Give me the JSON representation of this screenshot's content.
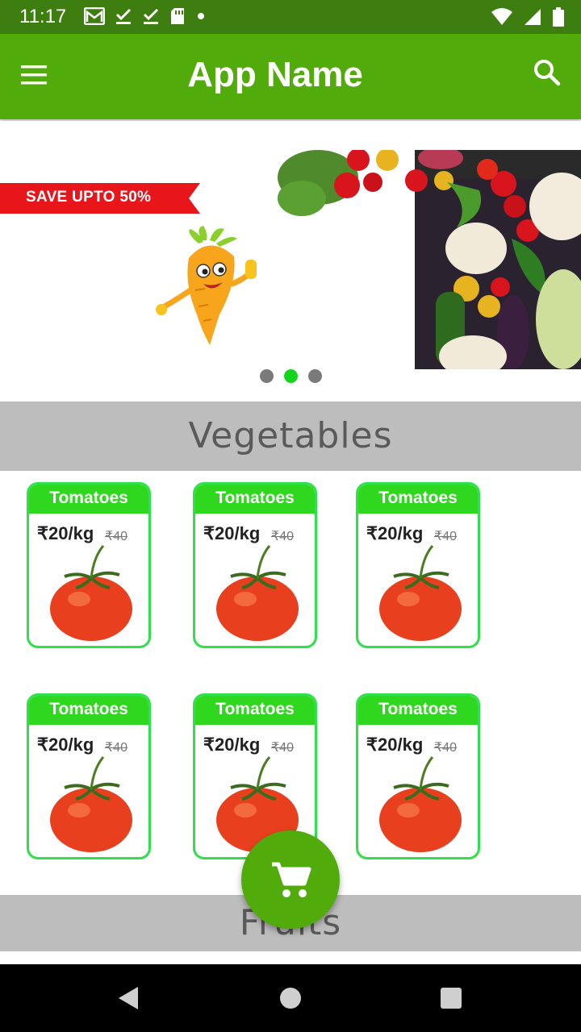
{
  "status_bar": {
    "time": "11:17",
    "left_icons": [
      "gmail-icon",
      "check-icon",
      "check-icon",
      "sd-card-icon",
      "dot-icon"
    ],
    "right_icons": [
      "wifi-icon",
      "signal-icon",
      "battery-icon"
    ]
  },
  "app_bar": {
    "title": "App Name",
    "menu_icon": "menu-icon",
    "search_icon": "search-icon",
    "color": "#51ac0b"
  },
  "banner": {
    "save_label": "SAVE UPTO 50%",
    "ribbon_color": "#e8151b",
    "dots_count": 3,
    "active_dot": 1,
    "active_dot_color": "#14d31c"
  },
  "sections": {
    "vegetables": "Vegetables",
    "fruits": "Fruits"
  },
  "products": [
    {
      "name": "Tomatoes",
      "price": "₹20/kg",
      "old_price": "₹40"
    },
    {
      "name": "Tomatoes",
      "price": "₹20/kg",
      "old_price": "₹40"
    },
    {
      "name": "Tomatoes",
      "price": "₹20/kg",
      "old_price": "₹40"
    },
    {
      "name": "Tomatoes",
      "price": "₹20/kg",
      "old_price": "₹40"
    },
    {
      "name": "Tomatoes",
      "price": "₹20/kg",
      "old_price": "₹40"
    },
    {
      "name": "Tomatoes",
      "price": "₹20/kg",
      "old_price": "₹40"
    }
  ],
  "fab": {
    "icon": "cart-icon"
  },
  "nav_bar": {
    "icons": [
      "back-icon",
      "home-icon",
      "recents-icon"
    ]
  }
}
